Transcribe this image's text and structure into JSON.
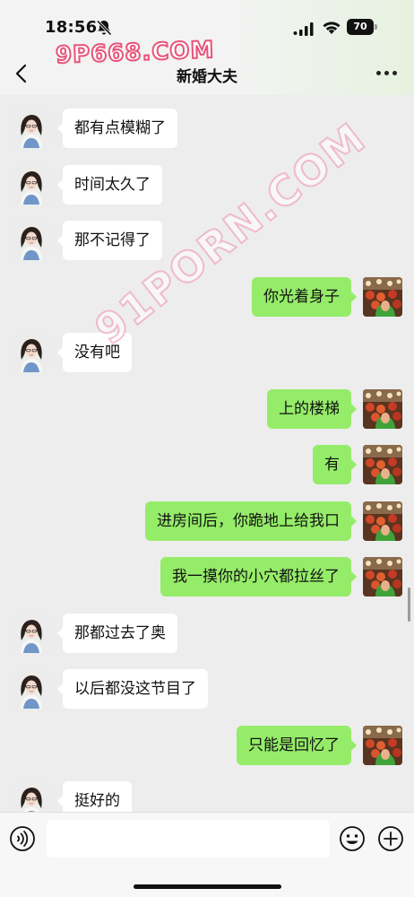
{
  "status_bar": {
    "time": "18:56",
    "battery": "70",
    "icons": [
      "bell-off-icon",
      "signal-icon",
      "wifi-icon",
      "battery-icon"
    ]
  },
  "watermarks": {
    "top": "9P668.COM",
    "diagonal": "91PORN.COM"
  },
  "header": {
    "title": "新婚大夫",
    "back_icon": "chevron-left-icon",
    "more_icon": "more-dots-icon"
  },
  "messages": [
    {
      "side": "in",
      "text": "都有点模糊了"
    },
    {
      "side": "in",
      "text": "时间太久了"
    },
    {
      "side": "in",
      "text": "那不记得了"
    },
    {
      "side": "out",
      "text": "你光着身子"
    },
    {
      "side": "in",
      "text": "没有吧"
    },
    {
      "side": "out",
      "text": "上的楼梯"
    },
    {
      "side": "out",
      "text": "有"
    },
    {
      "side": "out",
      "text": "进房间后，你跪地上给我口"
    },
    {
      "side": "out",
      "text": "我一摸你的小穴都拉丝了"
    },
    {
      "side": "in",
      "text": "那都过去了奥"
    },
    {
      "side": "in",
      "text": "以后都没这节目了"
    },
    {
      "side": "out",
      "text": "只能是回忆了"
    },
    {
      "side": "in",
      "text": "挺好的"
    }
  ],
  "input_bar": {
    "placeholder": "",
    "voice_icon": "voice-icon",
    "emoji_icon": "emoji-icon",
    "plus_icon": "plus-icon"
  },
  "colors": {
    "background": "#ededed",
    "incoming_bubble": "#ffffff",
    "outgoing_bubble": "#95ec69",
    "watermark": "#e8547a"
  }
}
